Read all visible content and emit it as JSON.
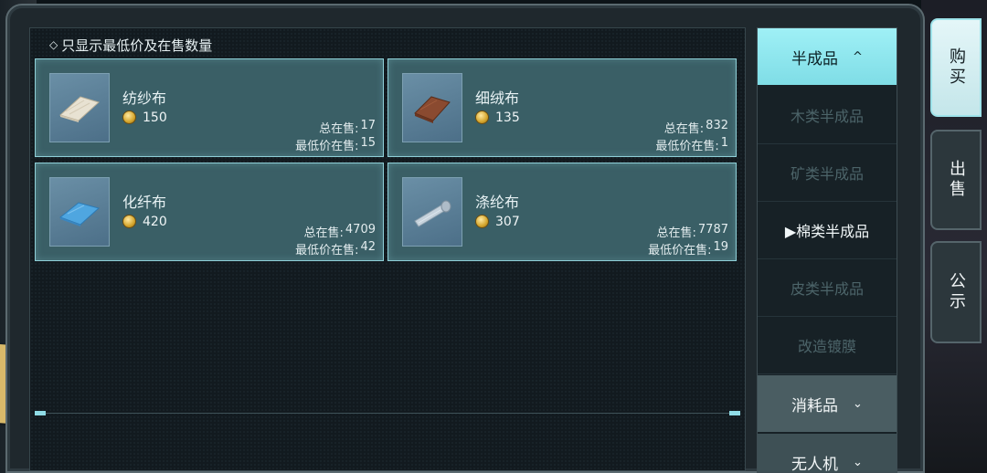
{
  "filter": {
    "label": "只显示最低价及在售数量",
    "checked": false
  },
  "items": [
    {
      "name": "纺纱布",
      "price": "150",
      "total_label": "总在售:",
      "total": "17",
      "min_label": "最低价在售:",
      "min": "15",
      "icon": "yarn-cloth-icon"
    },
    {
      "name": "细绒布",
      "price": "135",
      "total_label": "总在售:",
      "total": "832",
      "min_label": "最低价在售:",
      "min": "1",
      "icon": "velvet-cloth-icon"
    },
    {
      "name": "化纤布",
      "price": "420",
      "total_label": "总在售:",
      "total": "4709",
      "min_label": "最低价在售:",
      "min": "42",
      "icon": "synthetic-cloth-icon"
    },
    {
      "name": "涤纶布",
      "price": "307",
      "total_label": "总在售:",
      "total": "7787",
      "min_label": "最低价在售:",
      "min": "19",
      "icon": "polyester-cloth-icon"
    }
  ],
  "categories": {
    "semi_finished": {
      "label": "半成品",
      "chevron": "^"
    },
    "sub_items": [
      {
        "label": "木类半成品"
      },
      {
        "label": "矿类半成品"
      },
      {
        "label": "▶棉类半成品"
      },
      {
        "label": "皮类半成品"
      },
      {
        "label": "改造镀膜"
      }
    ],
    "consumables": {
      "label": "消耗品",
      "chevron": "⌄"
    },
    "drones": {
      "label": "无人机",
      "chevron": "⌄"
    }
  },
  "side_tabs": [
    {
      "label": "购买"
    },
    {
      "label": "出售"
    },
    {
      "label": "公示"
    }
  ],
  "colors": {
    "accent_cyan": "#8fdce6",
    "card_bg": "#3a5f66",
    "coin_gold": "#d4a52c"
  }
}
